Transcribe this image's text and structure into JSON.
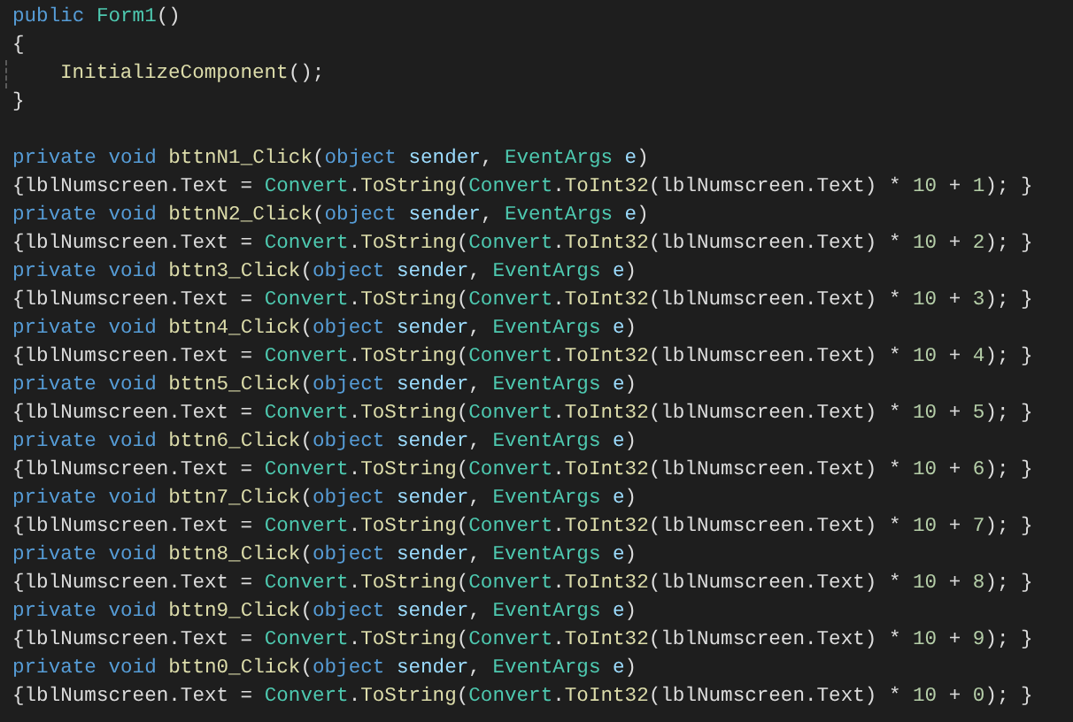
{
  "editor": {
    "blocks": [
      {
        "lines": [
          {
            "tokens": [
              {
                "text": "public ",
                "kind": "keyword"
              },
              {
                "text": "Form1",
                "kind": "type"
              },
              {
                "text": "()",
                "kind": "plain"
              }
            ]
          },
          {
            "tokens": [
              {
                "text": "{",
                "kind": "plain"
              }
            ]
          },
          {
            "indented": true,
            "tokens": [
              {
                "text": "InitializeComponent",
                "kind": "method"
              },
              {
                "text": "();",
                "kind": "plain"
              }
            ]
          },
          {
            "tokens": [
              {
                "text": "}",
                "kind": "plain"
              }
            ]
          }
        ]
      },
      {
        "lines": [
          {
            "tokens": [
              {
                "text": "private void ",
                "kind": "keyword"
              },
              {
                "text": "bttnN1_Click",
                "kind": "method"
              },
              {
                "text": "(",
                "kind": "plain"
              },
              {
                "text": "object ",
                "kind": "keyword"
              },
              {
                "text": "sender",
                "kind": "param"
              },
              {
                "text": ", ",
                "kind": "plain"
              },
              {
                "text": "EventArgs ",
                "kind": "type"
              },
              {
                "text": "e",
                "kind": "param"
              },
              {
                "text": ")",
                "kind": "plain"
              }
            ]
          },
          {
            "tokens": [
              {
                "text": "{lblNumscreen.Text = ",
                "kind": "plain"
              },
              {
                "text": "Convert",
                "kind": "type"
              },
              {
                "text": ".",
                "kind": "plain"
              },
              {
                "text": "ToString",
                "kind": "method"
              },
              {
                "text": "(",
                "kind": "plain"
              },
              {
                "text": "Convert",
                "kind": "type"
              },
              {
                "text": ".",
                "kind": "plain"
              },
              {
                "text": "ToInt32",
                "kind": "method"
              },
              {
                "text": "(lblNumscreen.Text) * ",
                "kind": "plain"
              },
              {
                "text": "10",
                "kind": "number"
              },
              {
                "text": " + ",
                "kind": "plain"
              },
              {
                "text": "1",
                "kind": "number"
              },
              {
                "text": "); }",
                "kind": "plain"
              }
            ]
          },
          {
            "tokens": [
              {
                "text": "private void ",
                "kind": "keyword"
              },
              {
                "text": "bttnN2_Click",
                "kind": "method"
              },
              {
                "text": "(",
                "kind": "plain"
              },
              {
                "text": "object ",
                "kind": "keyword"
              },
              {
                "text": "sender",
                "kind": "param"
              },
              {
                "text": ", ",
                "kind": "plain"
              },
              {
                "text": "EventArgs ",
                "kind": "type"
              },
              {
                "text": "e",
                "kind": "param"
              },
              {
                "text": ")",
                "kind": "plain"
              }
            ]
          },
          {
            "tokens": [
              {
                "text": "{lblNumscreen.Text = ",
                "kind": "plain"
              },
              {
                "text": "Convert",
                "kind": "type"
              },
              {
                "text": ".",
                "kind": "plain"
              },
              {
                "text": "ToString",
                "kind": "method"
              },
              {
                "text": "(",
                "kind": "plain"
              },
              {
                "text": "Convert",
                "kind": "type"
              },
              {
                "text": ".",
                "kind": "plain"
              },
              {
                "text": "ToInt32",
                "kind": "method"
              },
              {
                "text": "(lblNumscreen.Text) * ",
                "kind": "plain"
              },
              {
                "text": "10",
                "kind": "number"
              },
              {
                "text": " + ",
                "kind": "plain"
              },
              {
                "text": "2",
                "kind": "number"
              },
              {
                "text": "); }",
                "kind": "plain"
              }
            ]
          },
          {
            "tokens": [
              {
                "text": "private void ",
                "kind": "keyword"
              },
              {
                "text": "bttn3_Click",
                "kind": "method"
              },
              {
                "text": "(",
                "kind": "plain"
              },
              {
                "text": "object ",
                "kind": "keyword"
              },
              {
                "text": "sender",
                "kind": "param"
              },
              {
                "text": ", ",
                "kind": "plain"
              },
              {
                "text": "EventArgs ",
                "kind": "type"
              },
              {
                "text": "e",
                "kind": "param"
              },
              {
                "text": ")",
                "kind": "plain"
              }
            ]
          },
          {
            "tokens": [
              {
                "text": "{lblNumscreen.Text = ",
                "kind": "plain"
              },
              {
                "text": "Convert",
                "kind": "type"
              },
              {
                "text": ".",
                "kind": "plain"
              },
              {
                "text": "ToString",
                "kind": "method"
              },
              {
                "text": "(",
                "kind": "plain"
              },
              {
                "text": "Convert",
                "kind": "type"
              },
              {
                "text": ".",
                "kind": "plain"
              },
              {
                "text": "ToInt32",
                "kind": "method"
              },
              {
                "text": "(lblNumscreen.Text) * ",
                "kind": "plain"
              },
              {
                "text": "10",
                "kind": "number"
              },
              {
                "text": " + ",
                "kind": "plain"
              },
              {
                "text": "3",
                "kind": "number"
              },
              {
                "text": "); }",
                "kind": "plain"
              }
            ]
          },
          {
            "tokens": [
              {
                "text": "private void ",
                "kind": "keyword"
              },
              {
                "text": "bttn4_Click",
                "kind": "method"
              },
              {
                "text": "(",
                "kind": "plain"
              },
              {
                "text": "object ",
                "kind": "keyword"
              },
              {
                "text": "sender",
                "kind": "param"
              },
              {
                "text": ", ",
                "kind": "plain"
              },
              {
                "text": "EventArgs ",
                "kind": "type"
              },
              {
                "text": "e",
                "kind": "param"
              },
              {
                "text": ")",
                "kind": "plain"
              }
            ]
          },
          {
            "tokens": [
              {
                "text": "{lblNumscreen.Text = ",
                "kind": "plain"
              },
              {
                "text": "Convert",
                "kind": "type"
              },
              {
                "text": ".",
                "kind": "plain"
              },
              {
                "text": "ToString",
                "kind": "method"
              },
              {
                "text": "(",
                "kind": "plain"
              },
              {
                "text": "Convert",
                "kind": "type"
              },
              {
                "text": ".",
                "kind": "plain"
              },
              {
                "text": "ToInt32",
                "kind": "method"
              },
              {
                "text": "(lblNumscreen.Text) * ",
                "kind": "plain"
              },
              {
                "text": "10",
                "kind": "number"
              },
              {
                "text": " + ",
                "kind": "plain"
              },
              {
                "text": "4",
                "kind": "number"
              },
              {
                "text": "); }",
                "kind": "plain"
              }
            ]
          },
          {
            "tokens": [
              {
                "text": "private void ",
                "kind": "keyword"
              },
              {
                "text": "bttn5_Click",
                "kind": "method"
              },
              {
                "text": "(",
                "kind": "plain"
              },
              {
                "text": "object ",
                "kind": "keyword"
              },
              {
                "text": "sender",
                "kind": "param"
              },
              {
                "text": ", ",
                "kind": "plain"
              },
              {
                "text": "EventArgs ",
                "kind": "type"
              },
              {
                "text": "e",
                "kind": "param"
              },
              {
                "text": ")",
                "kind": "plain"
              }
            ]
          },
          {
            "tokens": [
              {
                "text": "{lblNumscreen.Text = ",
                "kind": "plain"
              },
              {
                "text": "Convert",
                "kind": "type"
              },
              {
                "text": ".",
                "kind": "plain"
              },
              {
                "text": "ToString",
                "kind": "method"
              },
              {
                "text": "(",
                "kind": "plain"
              },
              {
                "text": "Convert",
                "kind": "type"
              },
              {
                "text": ".",
                "kind": "plain"
              },
              {
                "text": "ToInt32",
                "kind": "method"
              },
              {
                "text": "(lblNumscreen.Text) * ",
                "kind": "plain"
              },
              {
                "text": "10",
                "kind": "number"
              },
              {
                "text": " + ",
                "kind": "plain"
              },
              {
                "text": "5",
                "kind": "number"
              },
              {
                "text": "); }",
                "kind": "plain"
              }
            ]
          },
          {
            "tokens": [
              {
                "text": "private void ",
                "kind": "keyword"
              },
              {
                "text": "bttn6_Click",
                "kind": "method"
              },
              {
                "text": "(",
                "kind": "plain"
              },
              {
                "text": "object ",
                "kind": "keyword"
              },
              {
                "text": "sender",
                "kind": "param"
              },
              {
                "text": ", ",
                "kind": "plain"
              },
              {
                "text": "EventArgs ",
                "kind": "type"
              },
              {
                "text": "e",
                "kind": "param"
              },
              {
                "text": ")",
                "kind": "plain"
              }
            ]
          },
          {
            "tokens": [
              {
                "text": "{lblNumscreen.Text = ",
                "kind": "plain"
              },
              {
                "text": "Convert",
                "kind": "type"
              },
              {
                "text": ".",
                "kind": "plain"
              },
              {
                "text": "ToString",
                "kind": "method"
              },
              {
                "text": "(",
                "kind": "plain"
              },
              {
                "text": "Convert",
                "kind": "type"
              },
              {
                "text": ".",
                "kind": "plain"
              },
              {
                "text": "ToInt32",
                "kind": "method"
              },
              {
                "text": "(lblNumscreen.Text) * ",
                "kind": "plain"
              },
              {
                "text": "10",
                "kind": "number"
              },
              {
                "text": " + ",
                "kind": "plain"
              },
              {
                "text": "6",
                "kind": "number"
              },
              {
                "text": "); }",
                "kind": "plain"
              }
            ]
          },
          {
            "tokens": [
              {
                "text": "private void ",
                "kind": "keyword"
              },
              {
                "text": "bttn7_Click",
                "kind": "method"
              },
              {
                "text": "(",
                "kind": "plain"
              },
              {
                "text": "object ",
                "kind": "keyword"
              },
              {
                "text": "sender",
                "kind": "param"
              },
              {
                "text": ", ",
                "kind": "plain"
              },
              {
                "text": "EventArgs ",
                "kind": "type"
              },
              {
                "text": "e",
                "kind": "param"
              },
              {
                "text": ")",
                "kind": "plain"
              }
            ]
          },
          {
            "tokens": [
              {
                "text": "{lblNumscreen.Text = ",
                "kind": "plain"
              },
              {
                "text": "Convert",
                "kind": "type"
              },
              {
                "text": ".",
                "kind": "plain"
              },
              {
                "text": "ToString",
                "kind": "method"
              },
              {
                "text": "(",
                "kind": "plain"
              },
              {
                "text": "Convert",
                "kind": "type"
              },
              {
                "text": ".",
                "kind": "plain"
              },
              {
                "text": "ToInt32",
                "kind": "method"
              },
              {
                "text": "(lblNumscreen.Text) * ",
                "kind": "plain"
              },
              {
                "text": "10",
                "kind": "number"
              },
              {
                "text": " + ",
                "kind": "plain"
              },
              {
                "text": "7",
                "kind": "number"
              },
              {
                "text": "); }",
                "kind": "plain"
              }
            ]
          },
          {
            "tokens": [
              {
                "text": "private void ",
                "kind": "keyword"
              },
              {
                "text": "bttn8_Click",
                "kind": "method"
              },
              {
                "text": "(",
                "kind": "plain"
              },
              {
                "text": "object ",
                "kind": "keyword"
              },
              {
                "text": "sender",
                "kind": "param"
              },
              {
                "text": ", ",
                "kind": "plain"
              },
              {
                "text": "EventArgs ",
                "kind": "type"
              },
              {
                "text": "e",
                "kind": "param"
              },
              {
                "text": ")",
                "kind": "plain"
              }
            ]
          },
          {
            "tokens": [
              {
                "text": "{lblNumscreen.Text = ",
                "kind": "plain"
              },
              {
                "text": "Convert",
                "kind": "type"
              },
              {
                "text": ".",
                "kind": "plain"
              },
              {
                "text": "ToString",
                "kind": "method"
              },
              {
                "text": "(",
                "kind": "plain"
              },
              {
                "text": "Convert",
                "kind": "type"
              },
              {
                "text": ".",
                "kind": "plain"
              },
              {
                "text": "ToInt32",
                "kind": "method"
              },
              {
                "text": "(lblNumscreen.Text) * ",
                "kind": "plain"
              },
              {
                "text": "10",
                "kind": "number"
              },
              {
                "text": " + ",
                "kind": "plain"
              },
              {
                "text": "8",
                "kind": "number"
              },
              {
                "text": "); }",
                "kind": "plain"
              }
            ]
          },
          {
            "tokens": [
              {
                "text": "private void ",
                "kind": "keyword"
              },
              {
                "text": "bttn9_Click",
                "kind": "method"
              },
              {
                "text": "(",
                "kind": "plain"
              },
              {
                "text": "object ",
                "kind": "keyword"
              },
              {
                "text": "sender",
                "kind": "param"
              },
              {
                "text": ", ",
                "kind": "plain"
              },
              {
                "text": "EventArgs ",
                "kind": "type"
              },
              {
                "text": "e",
                "kind": "param"
              },
              {
                "text": ")",
                "kind": "plain"
              }
            ]
          },
          {
            "tokens": [
              {
                "text": "{lblNumscreen.Text = ",
                "kind": "plain"
              },
              {
                "text": "Convert",
                "kind": "type"
              },
              {
                "text": ".",
                "kind": "plain"
              },
              {
                "text": "ToString",
                "kind": "method"
              },
              {
                "text": "(",
                "kind": "plain"
              },
              {
                "text": "Convert",
                "kind": "type"
              },
              {
                "text": ".",
                "kind": "plain"
              },
              {
                "text": "ToInt32",
                "kind": "method"
              },
              {
                "text": "(lblNumscreen.Text) * ",
                "kind": "plain"
              },
              {
                "text": "10",
                "kind": "number"
              },
              {
                "text": " + ",
                "kind": "plain"
              },
              {
                "text": "9",
                "kind": "number"
              },
              {
                "text": "); }",
                "kind": "plain"
              }
            ]
          },
          {
            "tokens": [
              {
                "text": "private void ",
                "kind": "keyword"
              },
              {
                "text": "bttn0_Click",
                "kind": "method"
              },
              {
                "text": "(",
                "kind": "plain"
              },
              {
                "text": "object ",
                "kind": "keyword"
              },
              {
                "text": "sender",
                "kind": "param"
              },
              {
                "text": ", ",
                "kind": "plain"
              },
              {
                "text": "EventArgs ",
                "kind": "type"
              },
              {
                "text": "e",
                "kind": "param"
              },
              {
                "text": ")",
                "kind": "plain"
              }
            ]
          },
          {
            "tokens": [
              {
                "text": "{lblNumscreen.Text = ",
                "kind": "plain"
              },
              {
                "text": "Convert",
                "kind": "type"
              },
              {
                "text": ".",
                "kind": "plain"
              },
              {
                "text": "ToString",
                "kind": "method"
              },
              {
                "text": "(",
                "kind": "plain"
              },
              {
                "text": "Convert",
                "kind": "type"
              },
              {
                "text": ".",
                "kind": "plain"
              },
              {
                "text": "ToInt32",
                "kind": "method"
              },
              {
                "text": "(lblNumscreen.Text) * ",
                "kind": "plain"
              },
              {
                "text": "10",
                "kind": "number"
              },
              {
                "text": " + ",
                "kind": "plain"
              },
              {
                "text": "0",
                "kind": "number"
              },
              {
                "text": "); }",
                "kind": "plain"
              }
            ]
          }
        ]
      }
    ]
  }
}
